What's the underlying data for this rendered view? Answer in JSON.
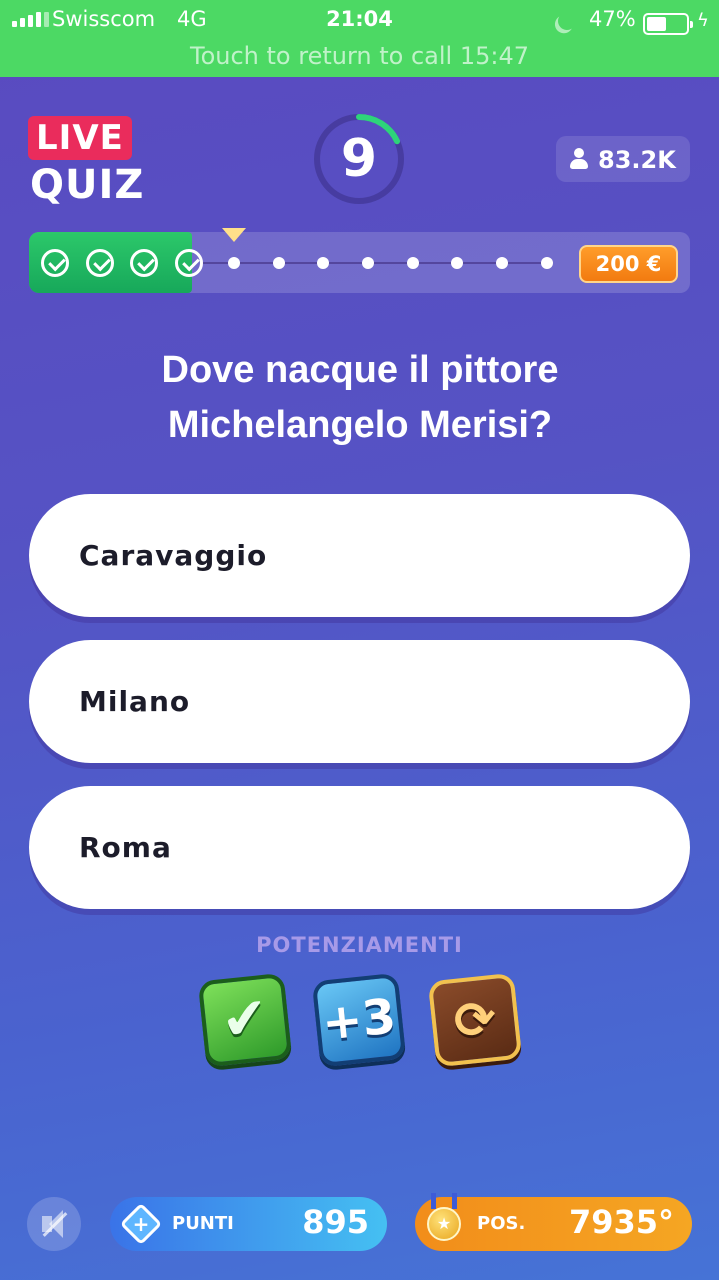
{
  "status_bar": {
    "carrier": "Swisscom",
    "network": "4G",
    "time": "21:04",
    "battery_percent": "47%",
    "battery_level": 0.47,
    "call_banner": "Touch to return to call 15:47"
  },
  "header": {
    "logo_live": "LIVE",
    "logo_quiz": "QUIZ",
    "timer_seconds": "9",
    "timer_fraction_remaining": 0.18,
    "players_count": "83.2K"
  },
  "progress": {
    "completed_steps": 4,
    "total_steps": 12,
    "prize": "200 €"
  },
  "question": {
    "line1": "Dove nacque il pittore",
    "line2": "Michelangelo Merisi?"
  },
  "answers": [
    {
      "label": "Caravaggio"
    },
    {
      "label": "Milano"
    },
    {
      "label": "Roma"
    }
  ],
  "powerups": {
    "title": "POTENZIAMENTI",
    "items": [
      {
        "icon": "check-powerup-icon",
        "glyph": "✔"
      },
      {
        "icon": "plus-three-powerup-icon",
        "glyph": "+3"
      },
      {
        "icon": "swap-powerup-icon",
        "glyph": "⟳"
      }
    ]
  },
  "footer": {
    "mute_icon": "sound-off-icon",
    "points_label": "PUNTI",
    "points_value": "895",
    "position_label": "POS.",
    "position_value": "7935°"
  },
  "colors": {
    "status_green": "#4cd964",
    "live_red": "#ea2c5c",
    "progress_green": "#1fb862",
    "prize_orange": "#f5901a",
    "timer_green": "#2ed47a"
  }
}
